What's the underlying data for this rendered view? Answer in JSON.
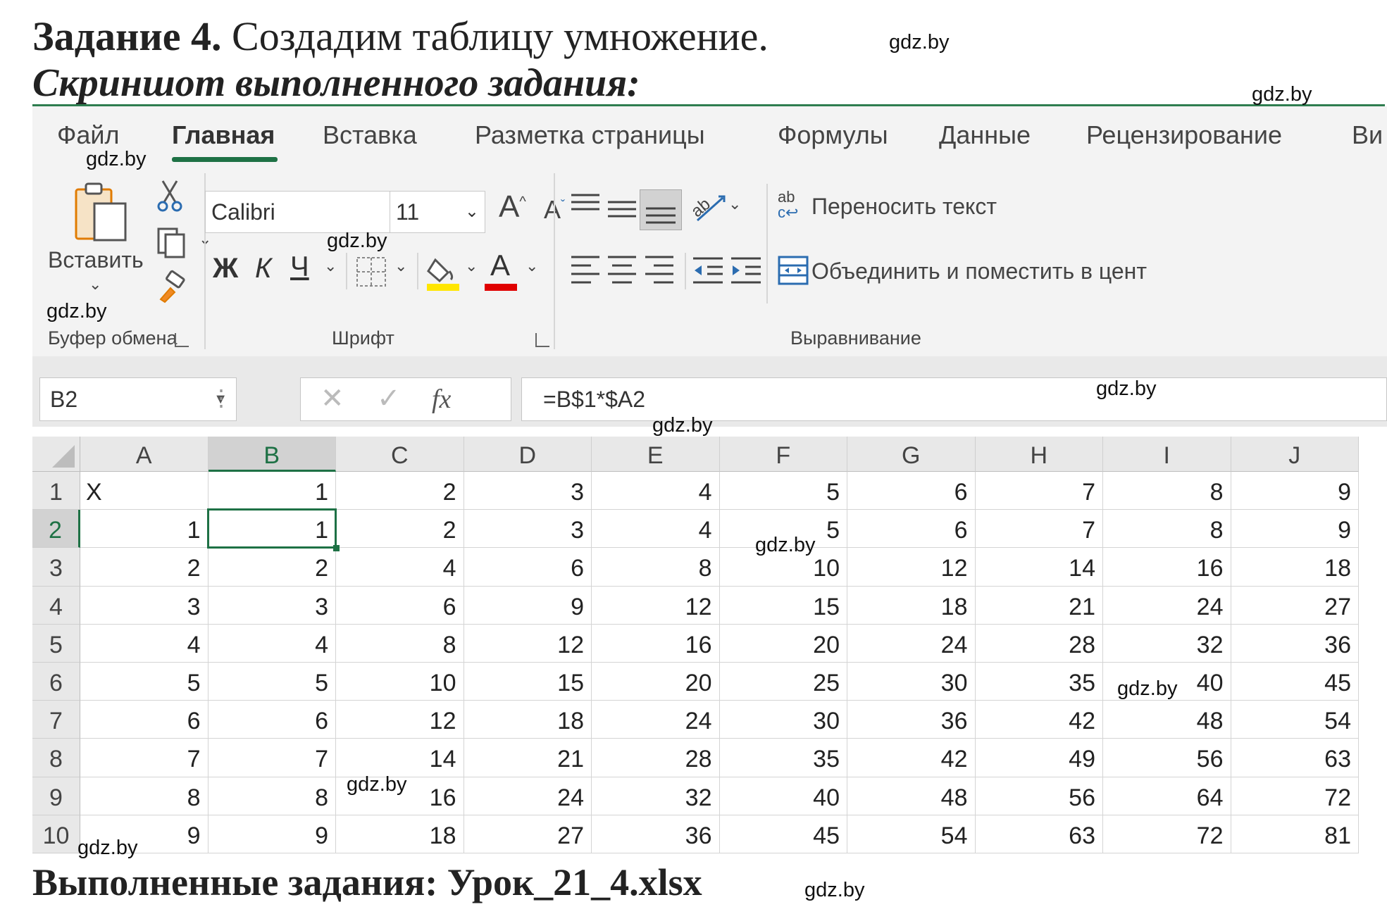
{
  "task": {
    "label": "Задание 4.",
    "text": "Создадим таблицу умножение."
  },
  "subtitle": "Скриншот выполненного задания:",
  "footer": "Выполненные задания: Урок_21_4.xlsx",
  "watermark": "gdz.by",
  "ribbon": {
    "tabs": [
      "Файл",
      "Главная",
      "Вставка",
      "Разметка страницы",
      "Формулы",
      "Данные",
      "Рецензирование",
      "Ви"
    ],
    "active_tab": "Главная",
    "clipboard": {
      "paste_label": "Вставить",
      "group_label": "Буфер обмена"
    },
    "font": {
      "font_name": "Calibri",
      "font_size": "11",
      "bold": "Ж",
      "italic": "К",
      "underline": "Ч",
      "grow": "A",
      "shrink": "A",
      "font_color_letter": "A",
      "group_label": "Шрифт"
    },
    "alignment": {
      "wrap_text": "Переносить текст",
      "merge_center": "Объединить и поместить в цент",
      "group_label": "Выравнивание"
    },
    "colors": {
      "accent": "#1e7145",
      "highlight": "#ffe600",
      "font_color": "#e00000"
    }
  },
  "formula_bar": {
    "name_box": "B2",
    "formula": "=B$1*$A2",
    "fx": "fx"
  },
  "sheet": {
    "columns": [
      "A",
      "B",
      "C",
      "D",
      "E",
      "F",
      "G",
      "H",
      "I",
      "J"
    ],
    "rows": [
      "1",
      "2",
      "3",
      "4",
      "5",
      "6",
      "7",
      "8",
      "9",
      "10"
    ],
    "selected_column": "B",
    "selected_row": "2",
    "cells": [
      [
        "X",
        "1",
        "2",
        "3",
        "4",
        "5",
        "6",
        "7",
        "8",
        "9"
      ],
      [
        "1",
        "1",
        "2",
        "3",
        "4",
        "5",
        "6",
        "7",
        "8",
        "9"
      ],
      [
        "2",
        "2",
        "4",
        "6",
        "8",
        "10",
        "12",
        "14",
        "16",
        "18"
      ],
      [
        "3",
        "3",
        "6",
        "9",
        "12",
        "15",
        "18",
        "21",
        "24",
        "27"
      ],
      [
        "4",
        "4",
        "8",
        "12",
        "16",
        "20",
        "24",
        "28",
        "32",
        "36"
      ],
      [
        "5",
        "5",
        "10",
        "15",
        "20",
        "25",
        "30",
        "35",
        "40",
        "45"
      ],
      [
        "6",
        "6",
        "12",
        "18",
        "24",
        "30",
        "36",
        "42",
        "48",
        "54"
      ],
      [
        "7",
        "7",
        "14",
        "21",
        "28",
        "35",
        "42",
        "49",
        "56",
        "63"
      ],
      [
        "8",
        "8",
        "16",
        "24",
        "32",
        "40",
        "48",
        "56",
        "64",
        "72"
      ],
      [
        "9",
        "9",
        "18",
        "27",
        "36",
        "45",
        "54",
        "63",
        "72",
        "81"
      ]
    ]
  }
}
